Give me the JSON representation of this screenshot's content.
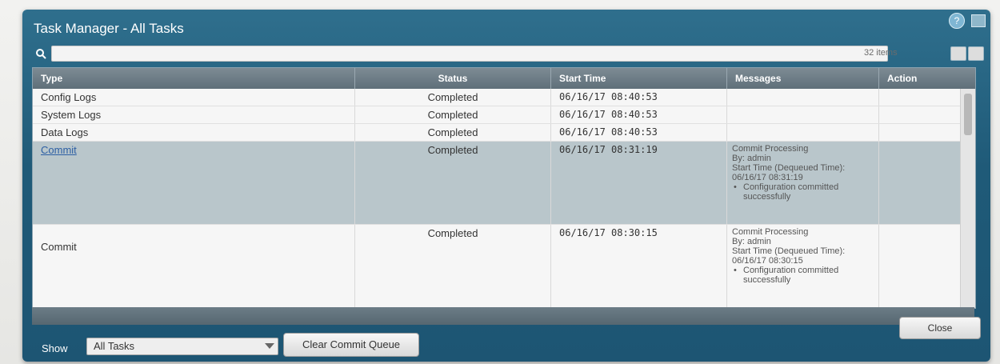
{
  "window": {
    "title": "Task Manager - All Tasks"
  },
  "toolbar": {
    "search_value": "",
    "items_count": "32 items"
  },
  "table": {
    "columns": {
      "type": "Type",
      "status": "Status",
      "start_time": "Start Time",
      "messages": "Messages",
      "action": "Action"
    },
    "rows": [
      {
        "type": "Config Logs",
        "status": "Completed",
        "start_time": "06/16/17 08:40:53",
        "messages": {}
      },
      {
        "type": "System Logs",
        "status": "Completed",
        "start_time": "06/16/17 08:40:53",
        "messages": {}
      },
      {
        "type": "Data Logs",
        "status": "Completed",
        "start_time": "06/16/17 08:40:53",
        "messages": {}
      },
      {
        "type": "Commit",
        "status": "Completed",
        "start_time": "06/16/17 08:31:19",
        "messages": {
          "line1": "Commit Processing",
          "line2": "By: admin",
          "line3": "Start Time (Dequeued Time): 06/16/17 08:31:19",
          "bullet": "Configuration committed successfully"
        }
      },
      {
        "type": "Commit",
        "status": "Completed",
        "start_time": "06/16/17 08:30:15",
        "messages": {
          "line1": "Commit Processing",
          "line2": "By: admin",
          "line3": "Start Time (Dequeued Time): 06/16/17 08:30:15",
          "bullet": "Configuration committed successfully"
        }
      }
    ]
  },
  "footer": {
    "show_label": "Show",
    "show_value": "All Tasks",
    "clear_button": "Clear Commit Queue",
    "close_button": "Close"
  }
}
